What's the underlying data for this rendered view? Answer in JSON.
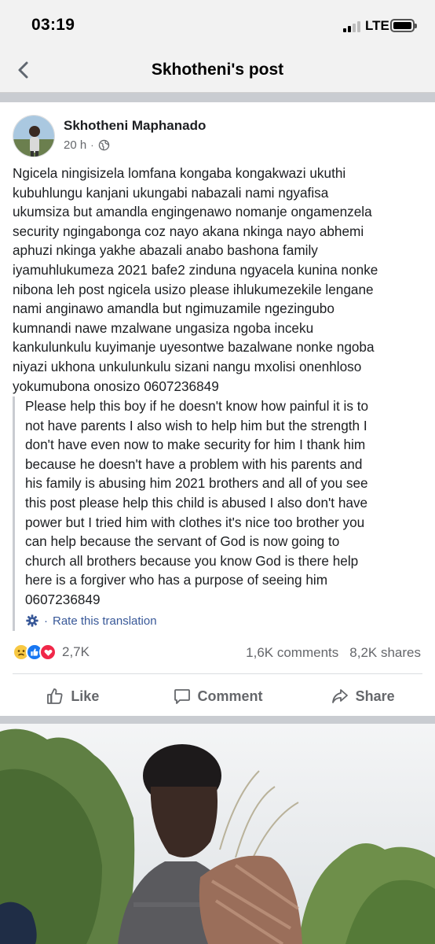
{
  "status_bar": {
    "time": "03:19",
    "network": "LTE",
    "icons": [
      "signal-icon",
      "battery-icon"
    ]
  },
  "nav": {
    "title": "Skhotheni's post",
    "back_icon": "chevron-left-icon"
  },
  "post": {
    "author": "Skhotheni Maphanado",
    "time": "20 h",
    "separator": "·",
    "privacy_icon": "globe-icon",
    "text": "Ngicela ningisizela lomfana kongaba kongakwazi ukuthi\nkubuhlungu kanjani ukungabi nabazali nami ngyafisa\nukumsiza but amandla engingenawo nomanje ongamenzela\nsecurity ngingabonga coz nayo akana nkinga nayo abhemi\naphuzi nkinga yakhe abazali anabo bashona family\niyamuhlukumeza 2021 bafe2 zinduna ngyacela kunina nonke\nnibona leh post ngicela usizo please ihlukumezekile lengane\nnami anginawo amandla but ngimuzamile ngezingubo\nkumnandi nawe mzalwane ungasiza ngoba inceku\nkankulunkulu kuyimanje uyesontwe bazalwane nonke ngoba\nniyazi ukhona unkulunkulu sizani nangu mxolisi onenhloso\nyokumubona onosizo 0607236849",
    "translation": "Please help this boy if he doesn't know how painful it is to\nnot have parents I also wish to help him but the strength I\ndon't have even now to make security for him I thank him\nbecause he doesn't have a problem with his parents and\nhis family is abusing him 2021 brothers and all of you see\nthis post please help this child is abused I also don't have\npower but I tried him with clothes it's nice too brother you\ncan help because the servant of God is now going to\nchurch all brothers because you know God is there help\nhere is a forgiver who has a purpose of seeing him\n0607236849",
    "rate_translation": "Rate this translation",
    "rate_separator": "·"
  },
  "engagement": {
    "reaction_icons": [
      "sad-reaction-icon",
      "like-reaction-icon",
      "love-reaction-icon"
    ],
    "reactions": "2,7K",
    "comments": "1,6K comments",
    "shares": "8,2K shares"
  },
  "actions": {
    "like": "Like",
    "comment": "Comment",
    "share": "Share"
  },
  "colors": {
    "header_bg": "#f2f2f2",
    "link": "#385898",
    "muted": "#65676b",
    "like_blue": "#1877f2",
    "love_red": "#f02849"
  }
}
